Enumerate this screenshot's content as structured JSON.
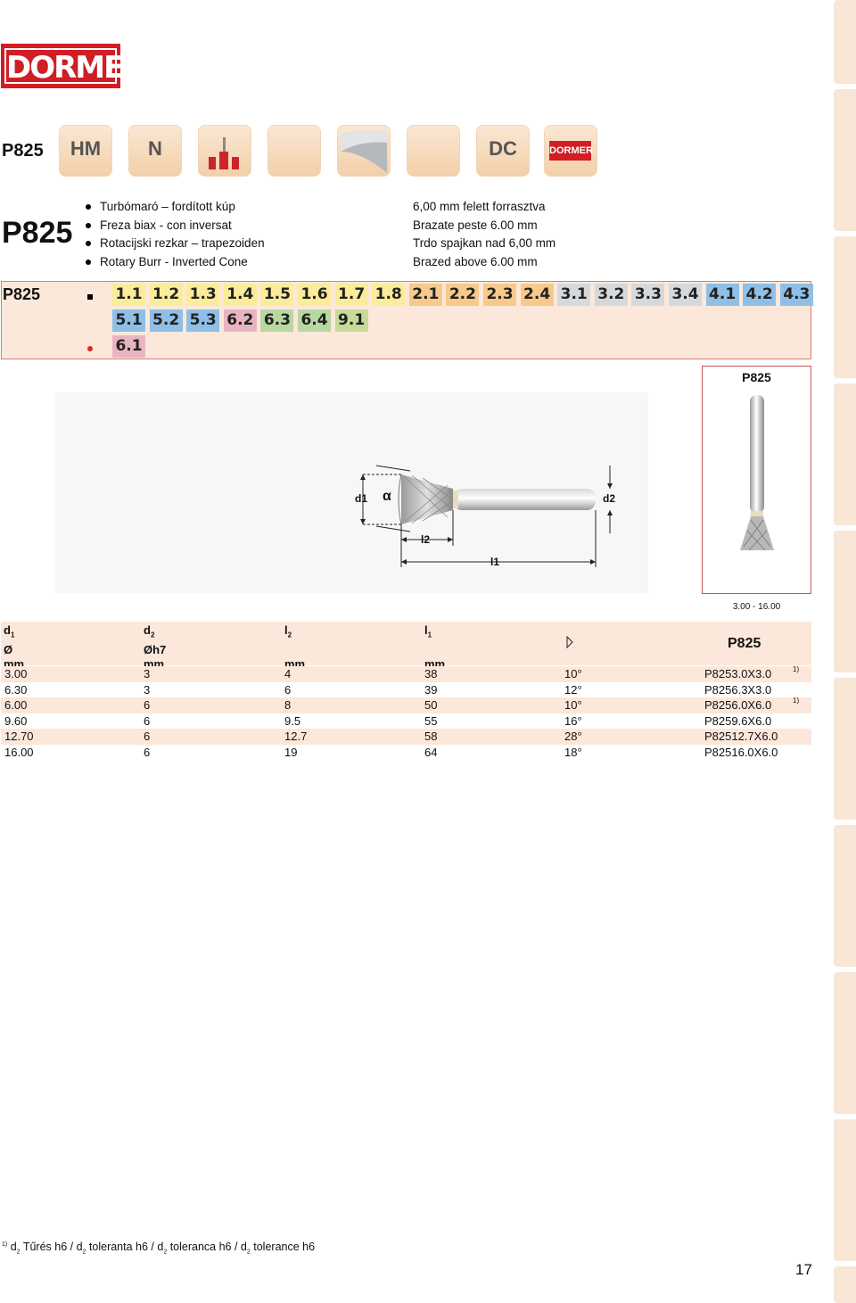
{
  "logo_text": "DORMER",
  "code": "P825",
  "icons": [
    "HM",
    "N",
    "DC",
    "DORMER"
  ],
  "description": [
    "Turbómaró – fordított kúp",
    "Freza biax - con inversat",
    "Rotacijski rezkar – trapezoiden",
    "Rotary Burr - Inverted Cone"
  ],
  "brazed": [
    "6,00 mm felett forrasztva",
    "Brazate peste 6.00 mm",
    "Trdo spajkan nad 6,00 mm",
    "Brazed above 6.00 mm"
  ],
  "materials": {
    "label": "P825",
    "primary": [
      {
        "code": "1.1",
        "color": "#fbec9c"
      },
      {
        "code": "1.2",
        "color": "#fbec9c"
      },
      {
        "code": "1.3",
        "color": "#fbec9c"
      },
      {
        "code": "1.4",
        "color": "#fbec9c"
      },
      {
        "code": "1.5",
        "color": "#fbec9c"
      },
      {
        "code": "1.6",
        "color": "#fbec9c"
      },
      {
        "code": "1.7",
        "color": "#fbec9c"
      },
      {
        "code": "1.8",
        "color": "#fbec9c"
      },
      {
        "code": "2.1",
        "color": "#f7c98a"
      },
      {
        "code": "2.2",
        "color": "#f7c98a"
      },
      {
        "code": "2.3",
        "color": "#f7c98a"
      },
      {
        "code": "2.4",
        "color": "#f7c98a"
      },
      {
        "code": "3.1",
        "color": "#d6d9dc"
      },
      {
        "code": "3.2",
        "color": "#d6d9dc"
      },
      {
        "code": "3.3",
        "color": "#d6d9dc"
      },
      {
        "code": "3.4",
        "color": "#d6d9dc"
      },
      {
        "code": "4.1",
        "color": "#8fbfe6"
      },
      {
        "code": "4.2",
        "color": "#8fbfe6"
      },
      {
        "code": "4.3",
        "color": "#8fbfe6"
      },
      {
        "code": "5.1",
        "color": "#8fbfe6"
      },
      {
        "code": "5.2",
        "color": "#8fbfe6"
      },
      {
        "code": "5.3",
        "color": "#8fbfe6"
      },
      {
        "code": "6.2",
        "color": "#e8b4c2"
      },
      {
        "code": "6.3",
        "color": "#b9d7a1"
      },
      {
        "code": "6.4",
        "color": "#b9d7a1"
      },
      {
        "code": "9.1",
        "color": "#c9d99a"
      }
    ],
    "secondary": [
      {
        "code": "6.1",
        "color": "#e8b4c2"
      }
    ]
  },
  "drawing_labels": {
    "d1": "d1",
    "alpha": "α",
    "d2": "d2",
    "l2": "l2",
    "l1": "l1"
  },
  "product_box_label": "P825",
  "range": "3.00 - 16.00",
  "table": {
    "headers": {
      "d1": {
        "sym": "d",
        "sub": "1",
        "line2": "Ø",
        "unit": "mm"
      },
      "d2": {
        "sym": "d",
        "sub": "2",
        "line2": "Øh7",
        "unit": "mm"
      },
      "l2": {
        "sym": "l",
        "sub": "2",
        "unit": "mm"
      },
      "l1": {
        "sym": "l",
        "sub": "1",
        "unit": "mm"
      },
      "code": "P825"
    },
    "rows": [
      {
        "d1": "3.00",
        "d2": "3",
        "l2": "4",
        "l1": "38",
        "angle": "10°",
        "code": "P8253.0X3.0",
        "note": "1)"
      },
      {
        "d1": "6.30",
        "d2": "3",
        "l2": "6",
        "l1": "39",
        "angle": "12°",
        "code": "P8256.3X3.0",
        "note": ""
      },
      {
        "d1": "6.00",
        "d2": "6",
        "l2": "8",
        "l1": "50",
        "angle": "10°",
        "code": "P8256.0X6.0",
        "note": "1)"
      },
      {
        "d1": "9.60",
        "d2": "6",
        "l2": "9.5",
        "l1": "55",
        "angle": "16°",
        "code": "P8259.6X6.0",
        "note": ""
      },
      {
        "d1": "12.70",
        "d2": "6",
        "l2": "12.7",
        "l1": "58",
        "angle": "28°",
        "code": "P82512.7X6.0",
        "note": ""
      },
      {
        "d1": "16.00",
        "d2": "6",
        "l2": "19",
        "l1": "64",
        "angle": "18°",
        "code": "P82516.0X6.0",
        "note": ""
      }
    ]
  },
  "footnote": {
    "mark": "1)",
    "parts": [
      {
        "sym": "d",
        "sub": "2",
        "text": " Tűrés h6 / "
      },
      {
        "sym": "d",
        "sub": "2",
        "text": " toleranta h6 / "
      },
      {
        "sym": "d",
        "sub": "2",
        "text": " toleranca h6 / "
      },
      {
        "sym": "d",
        "sub": "2",
        "text": " tolerance h6"
      }
    ]
  },
  "page_number": "17"
}
